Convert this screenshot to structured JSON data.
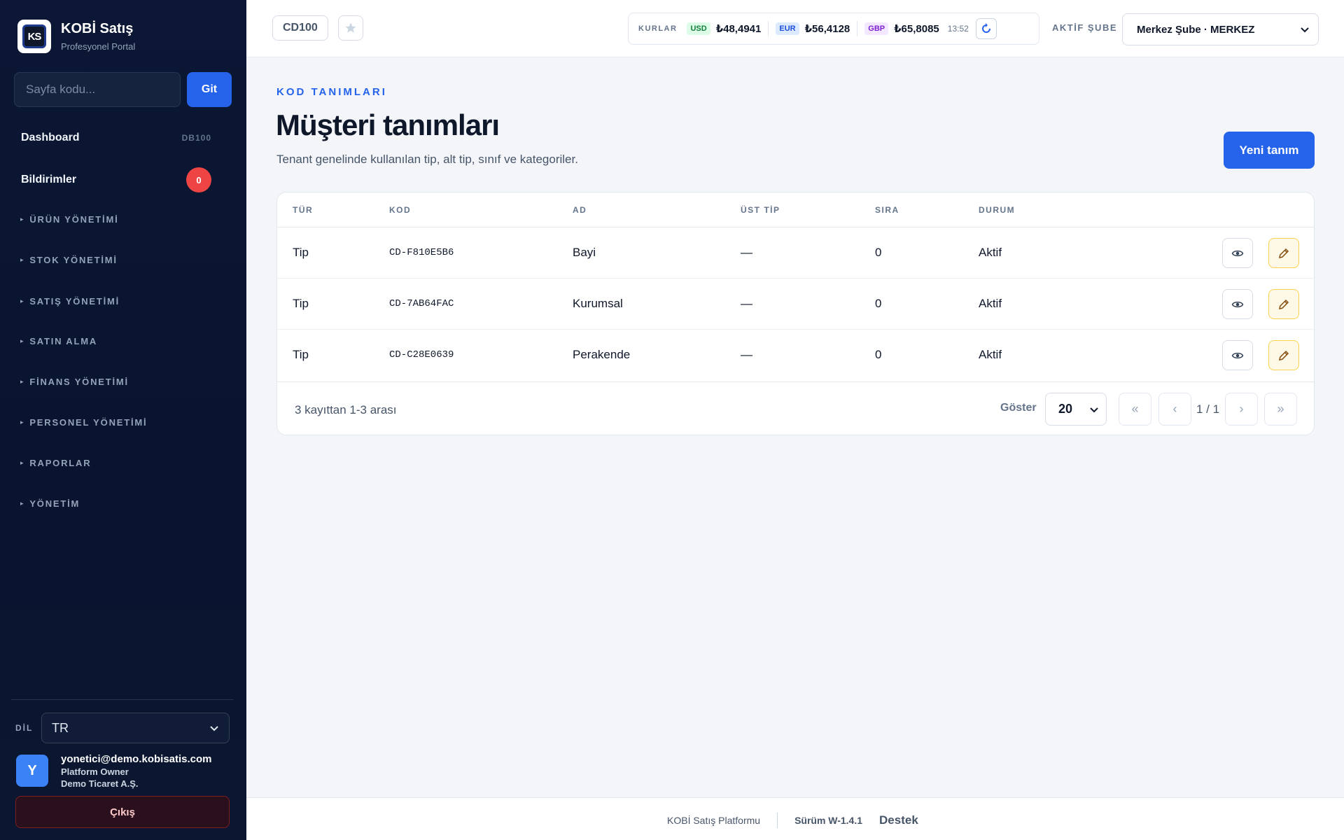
{
  "brand": {
    "title": "KOBİ Satış",
    "subtitle": "Profesyonel Portal",
    "logo_text": "KS"
  },
  "page_jump": {
    "placeholder": "Sayfa kodu...",
    "button": "Git"
  },
  "nav": {
    "dashboard": {
      "label": "Dashboard",
      "code": "DB100"
    },
    "notifications": {
      "label": "Bildirimler",
      "count": "0"
    },
    "groups": [
      "ÜRÜN YÖNETİMİ",
      "STOK YÖNETİMİ",
      "SATIŞ YÖNETİMİ",
      "SATIN ALMA",
      "FİNANS YÖNETİMİ",
      "PERSONEL YÖNETİMİ",
      "RAPORLAR",
      "YÖNETİM"
    ],
    "group_marker": "▸"
  },
  "language": {
    "label": "DİL",
    "value": "TR"
  },
  "user": {
    "initial": "Y",
    "email": "yonetici@demo.kobisatis.com",
    "role": "Platform Owner",
    "company": "Demo Ticaret A.Ş."
  },
  "logout_label": "Çıkış",
  "topbar": {
    "page_code": "CD100",
    "rates_label": "KURLAR",
    "rates": [
      {
        "code": "USD",
        "value": "₺48,4941"
      },
      {
        "code": "EUR",
        "value": "₺56,4128"
      },
      {
        "code": "GBP",
        "value": "₺65,8085"
      }
    ],
    "rates_time": "13:52",
    "branch_label": "AKTİF ŞUBE",
    "branch_value": "Merkez Şube · MERKEZ"
  },
  "page": {
    "eyebrow": "KOD TANIMLARI",
    "title": "Müşteri tanımları",
    "description": "Tenant genelinde kullanılan tip, alt tip, sınıf ve kategoriler.",
    "new_button": "Yeni tanım"
  },
  "table": {
    "columns": [
      "TÜR",
      "KOD",
      "AD",
      "ÜST TİP",
      "SIRA",
      "DURUM"
    ],
    "rows": [
      {
        "type": "Tip",
        "code": "CD-F810E5B6",
        "name": "Bayi",
        "parent": "—",
        "order": "0",
        "status": "Aktif"
      },
      {
        "type": "Tip",
        "code": "CD-7AB64FAC",
        "name": "Kurumsal",
        "parent": "—",
        "order": "0",
        "status": "Aktif"
      },
      {
        "type": "Tip",
        "code": "CD-C28E0639",
        "name": "Perakende",
        "parent": "—",
        "order": "0",
        "status": "Aktif"
      }
    ]
  },
  "pagination": {
    "range_text": "3 kayıttan 1-3 arası",
    "show_label": "Göster",
    "page_size": "20",
    "page_text": "1 / 1",
    "first": "«",
    "prev": "‹",
    "next": "›",
    "last": "»"
  },
  "footer": {
    "platform": "KOBİ Satış Platformu",
    "version": "Sürüm W-1.4.1",
    "support": "Destek"
  },
  "icons": {
    "star": "star-icon",
    "refresh": "refresh-icon",
    "view": "eye-icon",
    "edit": "pencil-icon",
    "dropdown": "chevron-down-icon"
  },
  "colors": {
    "accent": "#2563eb",
    "sidebar": "#0b1734",
    "danger": "#ef4444"
  }
}
